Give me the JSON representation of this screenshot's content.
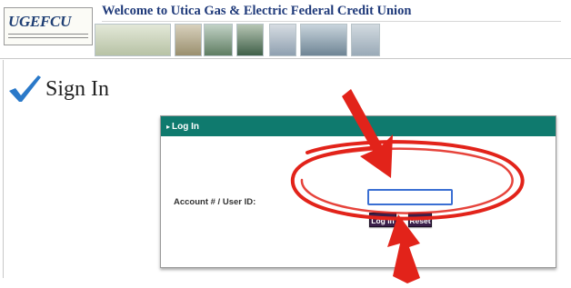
{
  "header": {
    "logo_text": "UGEFCU",
    "title": "Welcome to Utica Gas & Electric Federal Credit Union"
  },
  "page": {
    "title": "Sign In",
    "check_icon": "checkmark-icon"
  },
  "login_panel": {
    "header": "Log In",
    "account_label": "Account # / User ID:",
    "account_value": "",
    "login_button": "Log In",
    "reset_button": "Reset"
  },
  "colors": {
    "panel_header": "#0f7a6e",
    "button": "#3a1f4a",
    "input_border": "#3a6fd3",
    "annotation": "#e2231a",
    "checkmark": "#2a79c9"
  }
}
